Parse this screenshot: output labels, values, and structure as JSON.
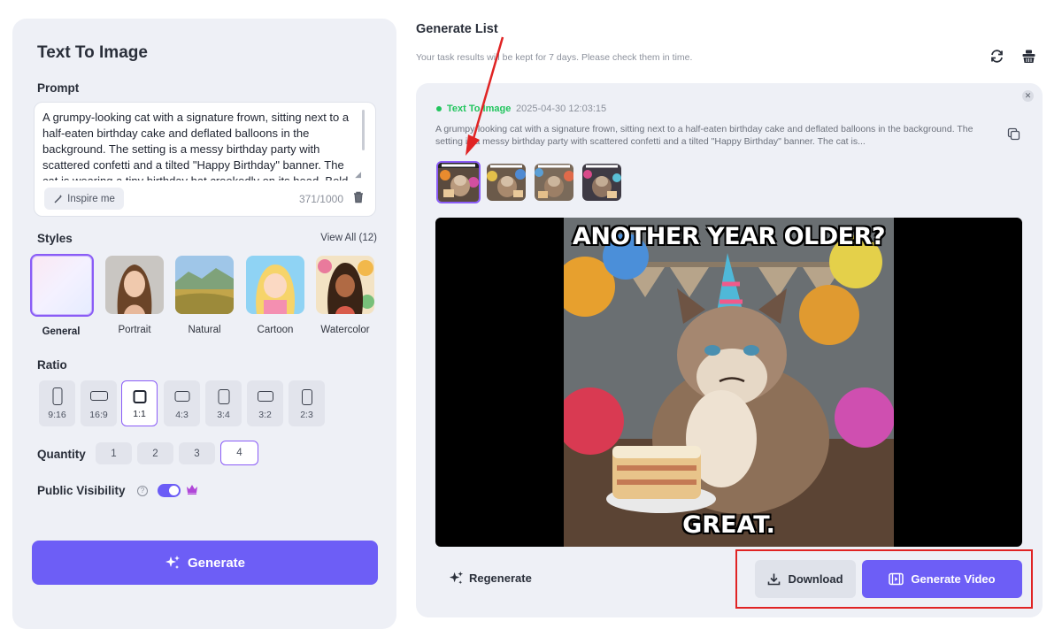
{
  "left": {
    "title": "Text To Image",
    "prompt_label": "Prompt",
    "prompt_text": "A grumpy-looking cat with a signature frown, sitting next to a half-eaten birthday cake and deflated balloons in the background. The setting is a messy birthday party with scattered confetti and a tilted \"Happy Birthday\" banner. The cat is wearing a tiny birthday hat crookedly on its head. Bold",
    "inspire_label": "Inspire me",
    "char_count": "371/1000",
    "styles_label": "Styles",
    "view_all": "View All (12)",
    "styles": [
      {
        "label": "General",
        "active": true
      },
      {
        "label": "Portrait"
      },
      {
        "label": "Natural"
      },
      {
        "label": "Cartoon"
      },
      {
        "label": "Watercolor"
      }
    ],
    "ratio_label": "Ratio",
    "ratios": [
      "9:16",
      "16:9",
      "1:1",
      "4:3",
      "3:4",
      "3:2",
      "2:3"
    ],
    "ratio_selected": "1:1",
    "quantity_label": "Quantity",
    "quantities": [
      "1",
      "2",
      "3",
      "4"
    ],
    "quantity_selected": "4",
    "visibility_label": "Public Visibility",
    "visibility_on": true,
    "generate_label": "Generate"
  },
  "right": {
    "title": "Generate List",
    "subtitle": "Your task results will be kept for 7 days. Please check them in time.",
    "task": {
      "type": "Text To Image",
      "time": "2025-04-30 12:03:15",
      "prompt": "A grumpy-looking cat with a signature frown, sitting next to a half-eaten birthday cake and deflated balloons in the background. The setting is a messy birthday party with scattered confetti and a tilted \"Happy Birthday\" banner. The cat is..."
    },
    "image_caption_top": "ANOTHER YEAR OLDER?",
    "image_caption_bottom": "GREAT.",
    "regenerate_label": "Regenerate",
    "download_label": "Download",
    "generate_video_label": "Generate Video"
  },
  "colors": {
    "accent": "#6d5ef6",
    "selection": "#8a5cf6",
    "status": "#22c55e",
    "annotation": "#e02424"
  }
}
